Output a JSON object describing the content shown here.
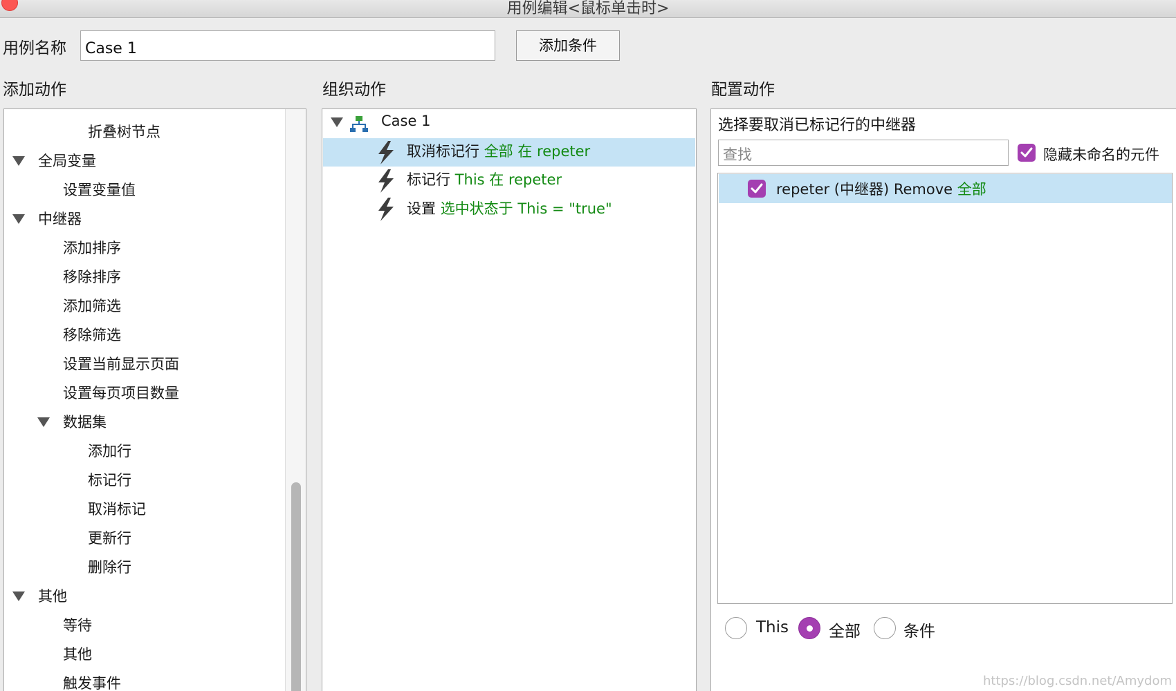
{
  "window": {
    "title": "用例编辑<鼠标单击时>"
  },
  "header": {
    "case_name_label": "用例名称",
    "case_name_value": "Case 1",
    "add_condition_label": "添加条件"
  },
  "sections": {
    "add_action": "添加动作",
    "organize_action": "组织动作",
    "configure_action": "配置动作"
  },
  "add_action_tree": {
    "items": [
      "折叠树节点",
      "全局变量",
      "设置变量值",
      "中继器",
      "添加排序",
      "移除排序",
      "添加筛选",
      "移除筛选",
      "设置当前显示页面",
      "设置每页项目数量",
      "数据集",
      "添加行",
      "标记行",
      "取消标记",
      "更新行",
      "删除行",
      "其他",
      "等待",
      "其他",
      "触发事件"
    ]
  },
  "organize": {
    "case_name": "Case 1",
    "actions": [
      {
        "verb": "取消标记行",
        "detail": "全部 在 repeter"
      },
      {
        "verb": "标记行",
        "detail": "This 在 repeter"
      },
      {
        "verb": "设置",
        "detail": "选中状态于 This = \"true\""
      }
    ]
  },
  "configure": {
    "heading": "选择要取消已标记行的中继器",
    "search_placeholder": "查找",
    "hide_unnamed_label": "隐藏未命名的元件",
    "target": {
      "name": "repeter (中继器) Remove",
      "detail": "全部"
    },
    "radio_options": [
      "This",
      "全部",
      "条件"
    ],
    "selected_radio": "全部"
  },
  "colors": {
    "accent_purple": "#a43fb1",
    "selection_blue": "#c5e3f5",
    "detail_green": "#138a13"
  },
  "watermark": "https://blog.csdn.net/Amydom"
}
